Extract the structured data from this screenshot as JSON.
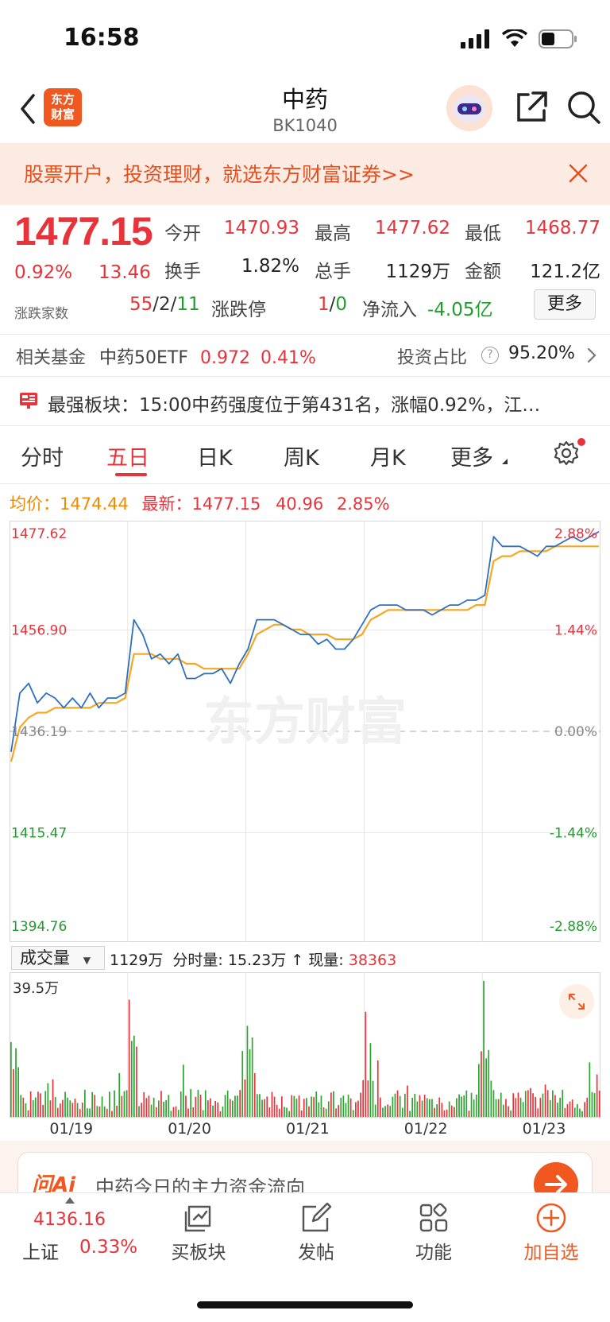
{
  "status_bar": {
    "time": "16:58"
  },
  "nav": {
    "logo_line1": "东方",
    "logo_line2": "财富",
    "title": "中药",
    "code": "BK1040"
  },
  "banner": {
    "text": "股票开户，投资理财，就选东方财富证券>>"
  },
  "quote": {
    "price": "1477.15",
    "change_pct": "0.92%",
    "change_val": "13.46",
    "open_label": "今开",
    "open": "1470.93",
    "high_label": "最高",
    "high": "1477.62",
    "low_label": "最低",
    "low": "1468.77",
    "turnover_label": "换手",
    "turnover": "1.82%",
    "volume_label": "总手",
    "volume": "1129万",
    "amount_label": "金额",
    "amount": "121.2亿",
    "adv_label": "涨跌家数",
    "adv_up": "55",
    "adv_flat": "2",
    "adv_down": "11",
    "slash": "/",
    "limit_label": "涨跌停",
    "limit_up": "1",
    "limit_down": "0",
    "netflow_label": "净流入",
    "netflow": "-4.05亿",
    "more": "更多"
  },
  "fund": {
    "label": "相关基金",
    "name": "中药50ETF",
    "price": "0.972",
    "pct": "0.41%",
    "ratio_label": "投资占比",
    "ratio_help": "?",
    "ratio": "95.20%"
  },
  "strong_sector": {
    "text": "最强板块：15:00中药强度位于第431名，涨幅0.92%，江…"
  },
  "tabs": {
    "t1": "分时",
    "t2": "五日",
    "t3": "日K",
    "t4": "周K",
    "t5": "月K",
    "t6": "更多"
  },
  "chart_header": {
    "avg_label": "均价：",
    "avg": "1474.44",
    "latest_label": "最新：",
    "latest": "1477.15",
    "chg": "40.96",
    "pct": "2.85%"
  },
  "chart_data": {
    "type": "line",
    "title": "",
    "y_left_ticks": [
      "1477.62",
      "1456.90",
      "1436.19",
      "1415.47",
      "1394.76"
    ],
    "y_right_ticks": [
      "2.88%",
      "1.44%",
      "0.00%",
      "-1.44%",
      "-2.88%"
    ],
    "ylim": [
      1394.76,
      1477.62
    ],
    "watermark": "东方财富",
    "x_categories": [
      "01/19",
      "01/20",
      "01/21",
      "01/22",
      "01/23"
    ],
    "series": [
      {
        "name": "最新",
        "color": "#2f6fc0",
        "values": [
          1432,
          1444,
          1446,
          1442,
          1444,
          1443,
          1441,
          1443,
          1441,
          1444,
          1441,
          1443,
          1443,
          1444,
          1459,
          1456,
          1451,
          1452,
          1450,
          1452,
          1447,
          1447,
          1448,
          1448,
          1449,
          1446,
          1450,
          1453,
          1459,
          1459,
          1459,
          1458,
          1457,
          1456,
          1456,
          1454,
          1455,
          1453,
          1453,
          1455,
          1458,
          1461,
          1462,
          1462,
          1462,
          1461,
          1461,
          1461,
          1460,
          1461,
          1462,
          1462,
          1463,
          1463,
          1464,
          1476,
          1474,
          1474,
          1474,
          1473,
          1472,
          1474,
          1474,
          1475,
          1476,
          1475,
          1476,
          1477
        ]
      },
      {
        "name": "均价",
        "color": "#f5a623",
        "values": [
          1430,
          1437,
          1439,
          1440,
          1440,
          1441,
          1441,
          1441,
          1441,
          1441,
          1442,
          1442,
          1442,
          1443,
          1452,
          1452,
          1452,
          1451,
          1451,
          1451,
          1450,
          1450,
          1449,
          1449,
          1449,
          1449,
          1449,
          1452,
          1456,
          1457,
          1458,
          1458,
          1457,
          1457,
          1456,
          1456,
          1456,
          1455,
          1455,
          1455,
          1456,
          1459,
          1460,
          1461,
          1461,
          1461,
          1461,
          1461,
          1461,
          1461,
          1461,
          1461,
          1461,
          1462,
          1462,
          1471,
          1472,
          1472,
          1473,
          1473,
          1473,
          1473,
          1474,
          1474,
          1474,
          1474,
          1474,
          1474
        ]
      }
    ]
  },
  "volume": {
    "select_label": "成交量",
    "total": "1129万",
    "minute_label": "分时量:",
    "minute": "15.23万",
    "arrow": "↑",
    "now_label": "现量:",
    "now": "38363",
    "max_label": "39.5万"
  },
  "ai": {
    "logo": "问Ai",
    "text": "中药今日的主力资金流向"
  },
  "bottom": {
    "index_value": "4136.16",
    "index_name": "上证",
    "index_pct": "0.33%",
    "buy_sector": "买板块",
    "post": "发帖",
    "functions": "功能",
    "add_watch": "加自选"
  },
  "colors": {
    "up": "#e8333a",
    "down": "#1f9d2b",
    "accent": "#f0581f",
    "price_line": "#2f6fc0",
    "avg_line": "#f5a623"
  }
}
